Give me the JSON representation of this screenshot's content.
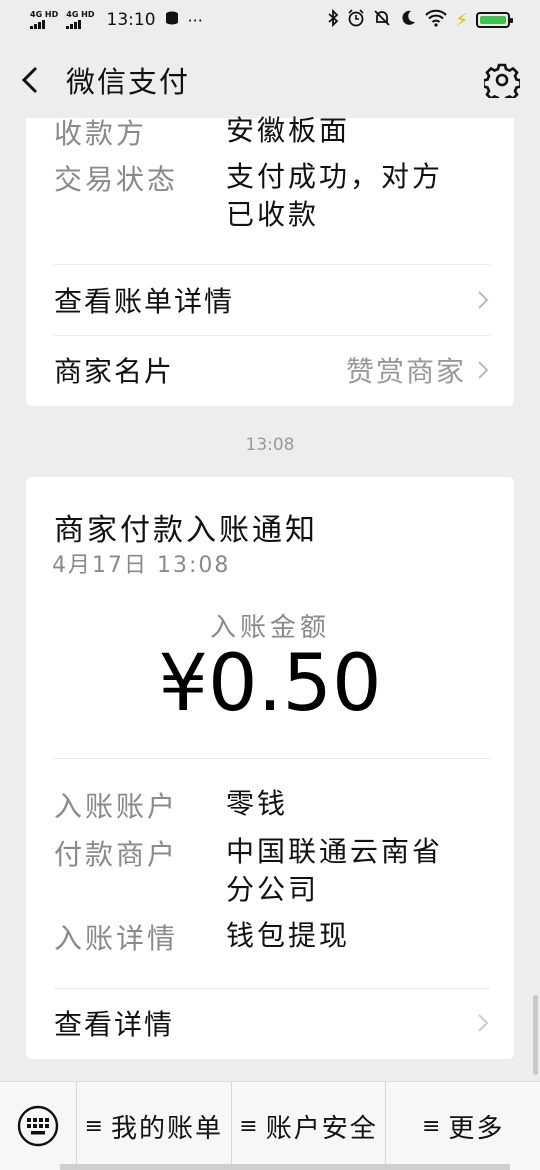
{
  "status_bar": {
    "net1": "4G HD",
    "net2": "4G HD",
    "time": "13:10",
    "more": "···"
  },
  "nav": {
    "title": "微信支付"
  },
  "card1": {
    "rows": [
      {
        "key": "收款方",
        "value": "安徽板面"
      },
      {
        "key": "交易状态",
        "value": "支付成功，对方已收款"
      }
    ],
    "bill_details_label": "查看账单详情",
    "merchant_card_label": "商家名片",
    "merchant_card_action": "赞赏商家"
  },
  "timestamp": "13:08",
  "card2": {
    "title": "商家付款入账通知",
    "date": "4月17日 13:08",
    "amount_label": "入账金额",
    "amount": "¥0.50",
    "rows": [
      {
        "key": "入账账户",
        "value": "零钱"
      },
      {
        "key": "付款商户",
        "value": "中国联通云南省分公司"
      },
      {
        "key": "入账详情",
        "value": "钱包提现"
      }
    ],
    "view_details_label": "查看详情"
  },
  "bottom_menu": {
    "items": [
      {
        "icon": "≡",
        "label": "我的账单"
      },
      {
        "icon": "≡",
        "label": "账户安全"
      },
      {
        "icon": "≡",
        "label": "更多"
      }
    ]
  },
  "colors": {
    "background": "#ededed",
    "card": "#ffffff",
    "muted_text": "#8a8a8a",
    "battery": "#3fc24a",
    "charging": "#e8b800"
  }
}
